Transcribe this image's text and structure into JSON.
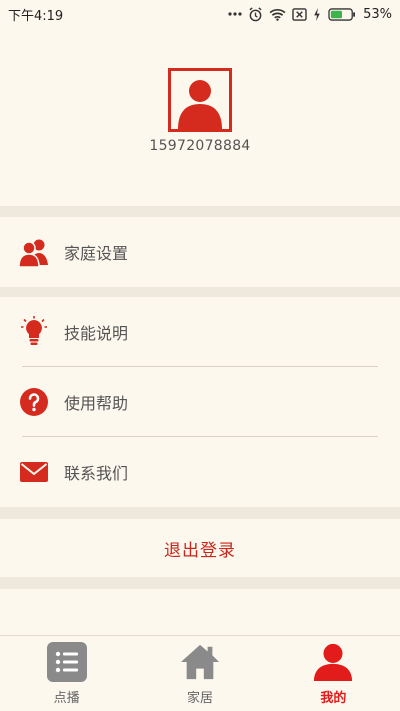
{
  "status_bar": {
    "time": "下午4:19",
    "battery": "53%"
  },
  "profile": {
    "phone": "15972078884"
  },
  "menu": {
    "family_settings": "家庭设置",
    "skills": "技能说明",
    "help": "使用帮助",
    "contact": "联系我们",
    "logout": "退出登录"
  },
  "tabs": [
    {
      "label": "点播",
      "icon": "list-icon"
    },
    {
      "label": "家居",
      "icon": "home-icon"
    },
    {
      "label": "我的",
      "icon": "person-icon",
      "active": true
    }
  ],
  "colors": {
    "accent": "#d52b1e",
    "tab_active": "#e21b1b",
    "background": "#fdf8ee",
    "separator": "#efe8dc"
  }
}
